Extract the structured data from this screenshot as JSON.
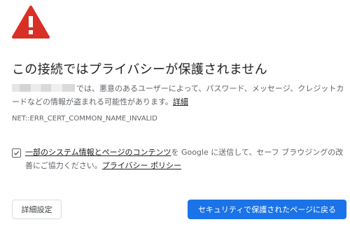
{
  "heading": "この接続ではプライバシーが保護されません",
  "description": {
    "text": "では、悪意のあるユーザーによって、パスワード、メッセージ、クレジットカードなどの情報が盗まれる可能性があります。",
    "link": "詳細"
  },
  "error_code": "NET::ERR_CERT_COMMON_NAME_INVALID",
  "optin": {
    "checked": true,
    "text": "一部のシステム情報とページのコンテンツを Google に送信して、セーフ ブラウジングの改善にご協力ください。",
    "link_text": "一部のシステム情報とページのコンテンツ",
    "text_middle": "を Google に送信して、セーフ ブラウジングの改善にご協力ください。",
    "privacy_link": "プライバシー ポリシー"
  },
  "buttons": {
    "advanced": "詳細設定",
    "back_to_safety": "セキュリティで保護されたページに戻る"
  },
  "icons": {
    "warning": "warning-triangle-icon",
    "checkbox": "checkmark-icon"
  },
  "colors": {
    "warning_red": "#d93025",
    "primary_blue": "#1a73e8"
  }
}
